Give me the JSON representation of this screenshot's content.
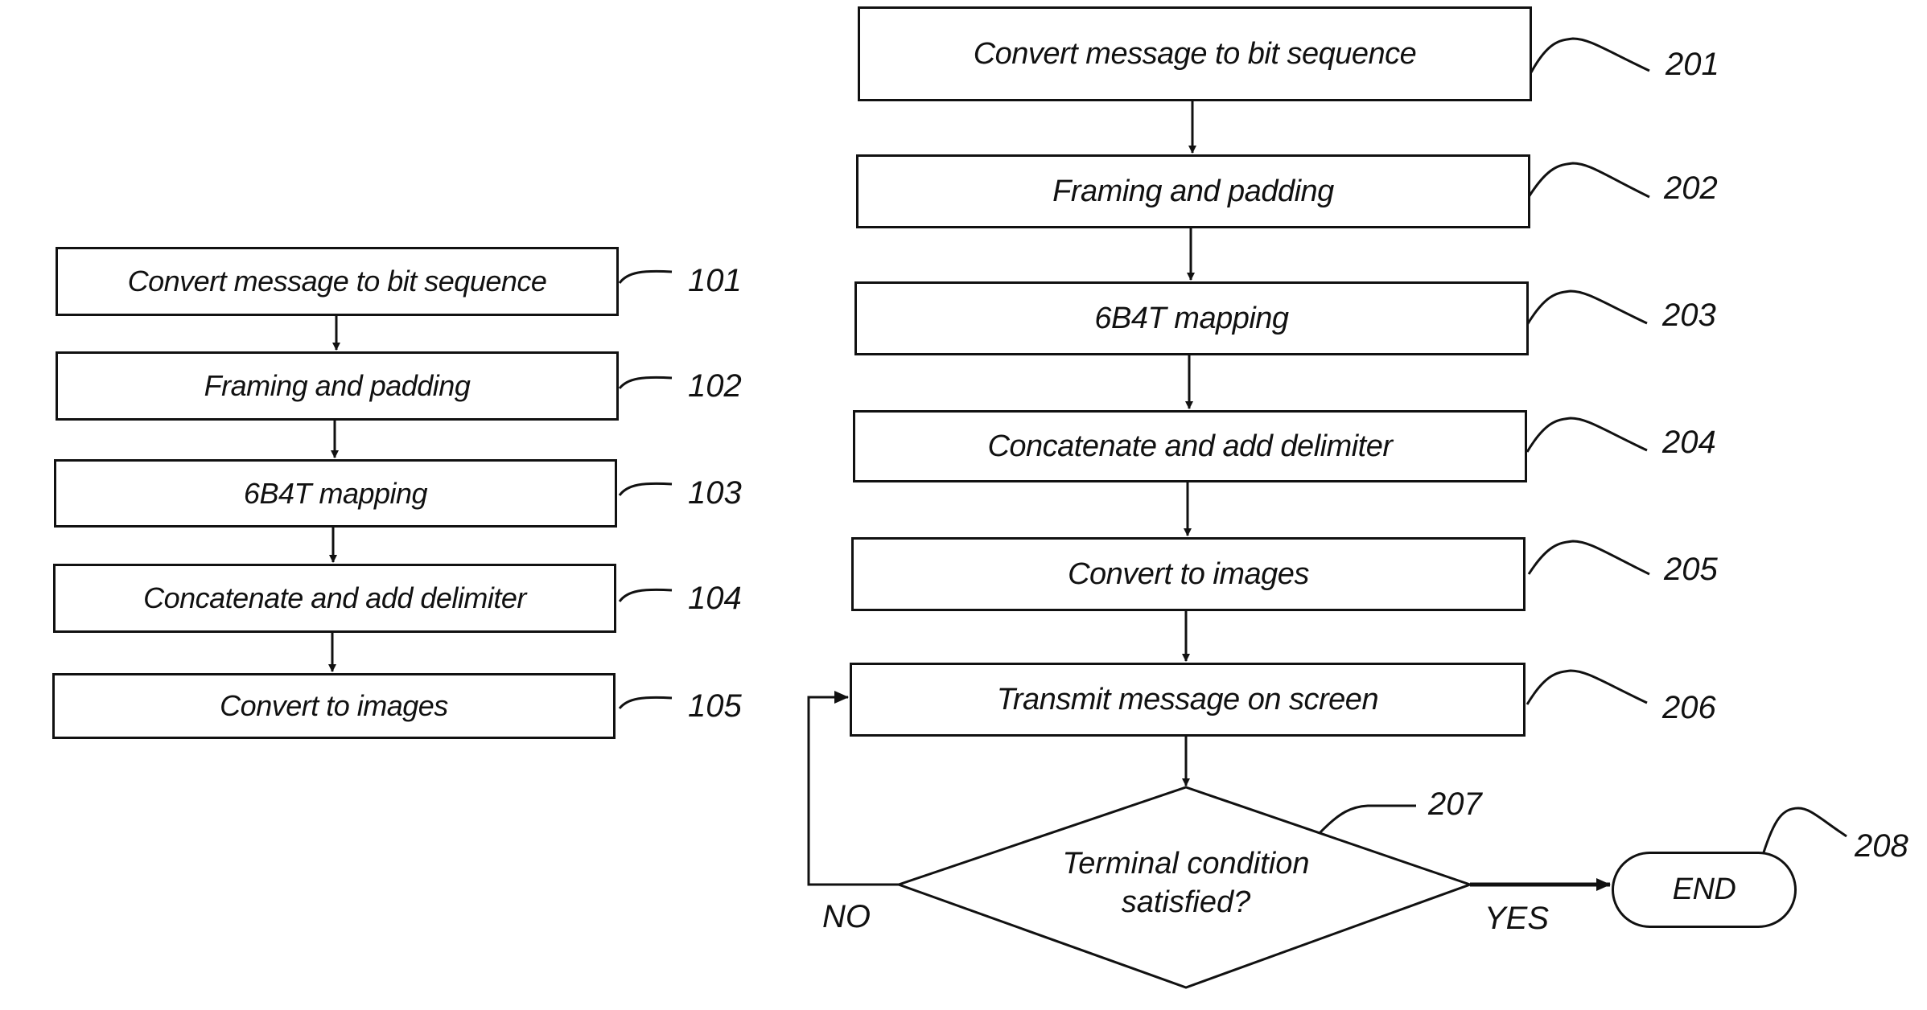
{
  "left_flow": {
    "steps": [
      {
        "label": "Convert message to bit sequence",
        "ref": "101"
      },
      {
        "label": "Framing and padding",
        "ref": "102"
      },
      {
        "label": "6B4T mapping",
        "ref": "103"
      },
      {
        "label": "Concatenate and add delimiter",
        "ref": "104"
      },
      {
        "label": "Convert to images",
        "ref": "105"
      }
    ]
  },
  "right_flow": {
    "steps": [
      {
        "label": "Convert message to bit sequence",
        "ref": "201"
      },
      {
        "label": "Framing and padding",
        "ref": "202"
      },
      {
        "label": "6B4T mapping",
        "ref": "203"
      },
      {
        "label": "Concatenate and add delimiter",
        "ref": "204"
      },
      {
        "label": "Convert to images",
        "ref": "205"
      },
      {
        "label": "Transmit message on screen",
        "ref": "206"
      }
    ],
    "decision": {
      "line1": "Terminal condition",
      "line2": "satisfied?",
      "ref": "207",
      "no_label": "NO",
      "yes_label": "YES"
    },
    "terminal": {
      "label": "END",
      "ref": "208"
    }
  }
}
